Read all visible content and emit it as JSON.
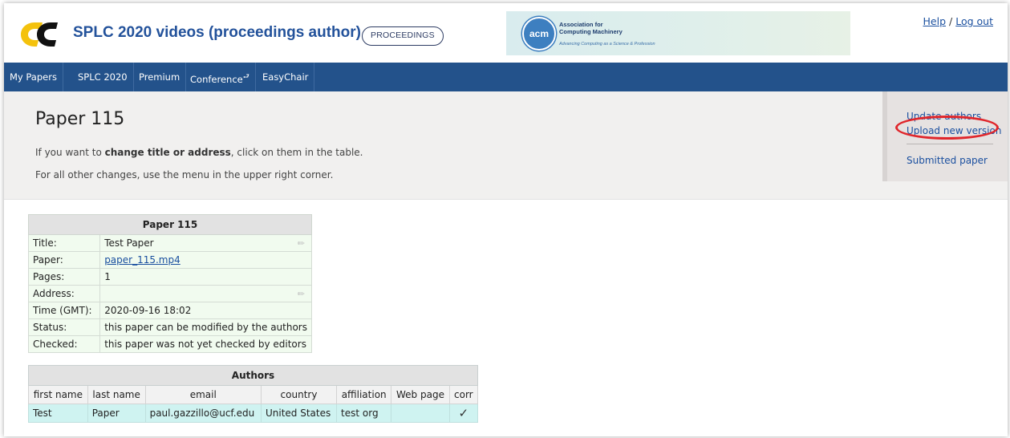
{
  "header": {
    "title": "SPLC 2020 videos (proceedings author) -",
    "badge": "PROCEEDINGS",
    "acm_line1": "Association for",
    "acm_line2": "Computing Machinery",
    "acm_tagline": "Advancing Computing as a Science & Profession",
    "acm_logo_text": "acm",
    "help": "Help",
    "separator": "/",
    "logout": "Log out"
  },
  "nav": [
    {
      "label": "My Papers"
    },
    {
      "label": "SPLC 2020"
    },
    {
      "label": "Premium"
    },
    {
      "label": "Conference"
    },
    {
      "label": "EasyChair"
    }
  ],
  "main": {
    "title": "Paper 115",
    "note1_pre": "If you want to ",
    "note1_bold": "change title or address",
    "note1_post": ", click on them in the table.",
    "note2": "For all other changes, use the menu in the upper right corner."
  },
  "side_menu": {
    "update_authors": "Update authors",
    "upload_new_version": "Upload new version",
    "submitted_paper": "Submitted paper"
  },
  "paper_table": {
    "caption": "Paper 115",
    "rows": [
      {
        "label": "Title:",
        "value": "Test Paper"
      },
      {
        "label": "Paper:",
        "value": "paper_115.mp4"
      },
      {
        "label": "Pages:",
        "value": "1"
      },
      {
        "label": "Address:",
        "value": ""
      },
      {
        "label": "Time (GMT):",
        "value": "2020-09-16 18:02"
      },
      {
        "label": "Status:",
        "value": "this paper can be modified by the authors"
      },
      {
        "label": "Checked:",
        "value": "this paper was not yet checked by editors"
      }
    ]
  },
  "authors_table": {
    "caption": "Authors",
    "columns": [
      "first name",
      "last name",
      "email",
      "country",
      "affiliation",
      "Web page",
      "corr"
    ],
    "rows": [
      {
        "first": "Test",
        "last": "Paper",
        "email": "paul.gazzillo@ucf.edu",
        "country": "United States",
        "affiliation": "test org",
        "web": "",
        "corr": "✓"
      }
    ]
  },
  "colors": {
    "nav_bg": "#23528b",
    "title_blue": "#23529b",
    "link_blue": "#1a4f9f",
    "logo_yellow": "#f4c20d",
    "highlight_red": "#e0262b",
    "author_row_bg": "#cff3f1",
    "paper_row_bg": "#f1fbef"
  },
  "icons": {
    "edit": "pencil-icon",
    "corr": "checkmark-icon",
    "conference_menu": "return-arrow-icon"
  }
}
